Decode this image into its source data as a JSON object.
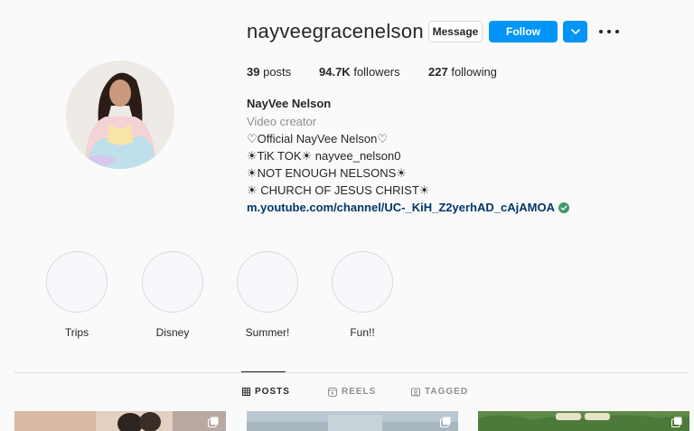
{
  "profile": {
    "username": "nayveegracenelson",
    "full_name": "NayVee Nelson",
    "category": "Video creator"
  },
  "actions": {
    "message_label": "Message",
    "follow_label": "Follow"
  },
  "stats": [
    {
      "value": "39",
      "label": "posts"
    },
    {
      "value": "94.7K",
      "label": "followers"
    },
    {
      "value": "227",
      "label": "following"
    }
  ],
  "bio": {
    "lines": [
      "♡Official NayVee Nelson♡",
      "☀TiK TOK☀ nayvee_nelson0",
      "☀NOT ENOUGH NELSONS☀",
      "☀ CHURCH OF JESUS CHRIST☀"
    ],
    "link": "m.youtube.com/channel/UC-_KiH_Z2yerhAD_cAjAMOA"
  },
  "highlights": [
    {
      "label": "Trips"
    },
    {
      "label": "Disney"
    },
    {
      "label": "Summer!"
    },
    {
      "label": "Fun!!"
    }
  ],
  "tabs": [
    {
      "label": "POSTS",
      "active": true
    },
    {
      "label": "REELS",
      "active": false
    },
    {
      "label": "TAGGED",
      "active": false
    }
  ],
  "colors": {
    "accent": "#0095f6",
    "link": "#00376b",
    "verified": "#3c9a6f",
    "background": "#fafafa"
  }
}
